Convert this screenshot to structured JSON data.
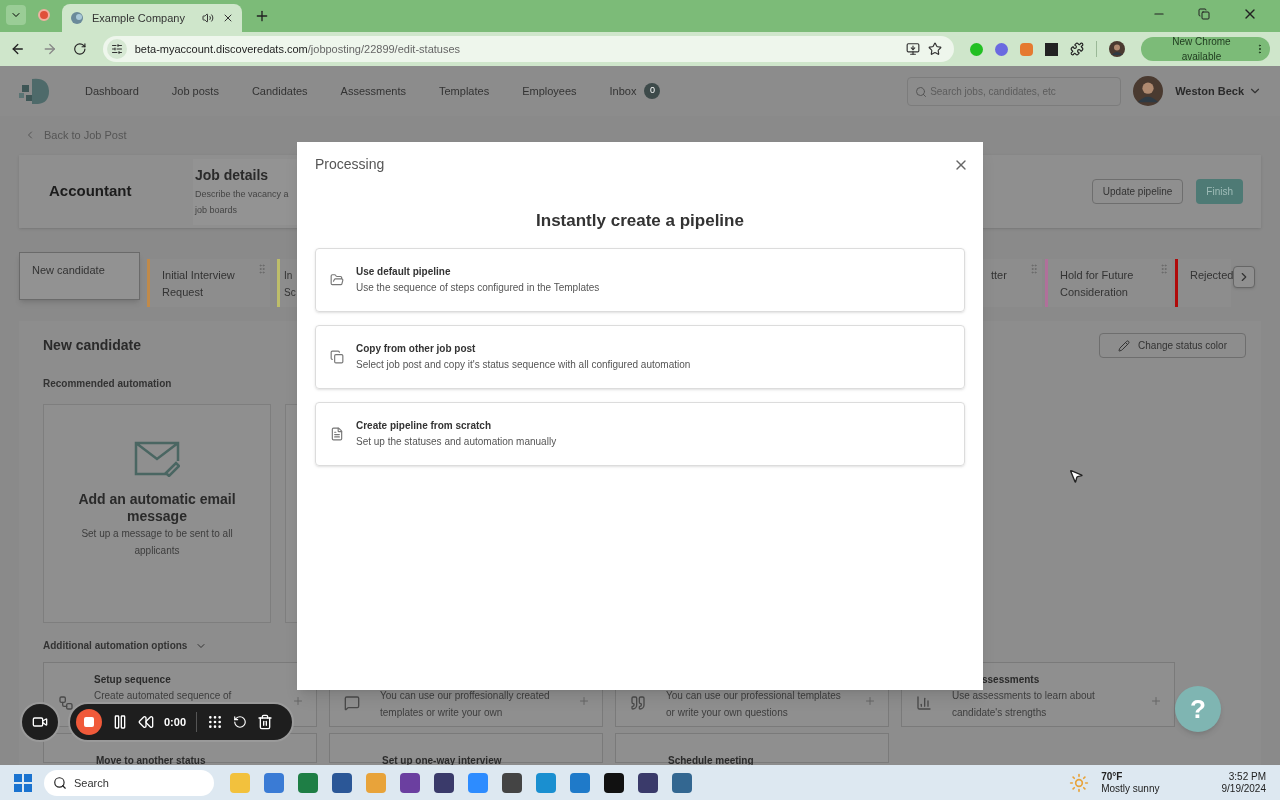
{
  "browser": {
    "tab_title": "Example Company",
    "url_host": "beta-myaccount.discoveredats.com",
    "url_path": "/jobposting/22899/edit-statuses",
    "update_button": "New Chrome available"
  },
  "nav": {
    "items": [
      {
        "label": "Dashboard"
      },
      {
        "label": "Job posts"
      },
      {
        "label": "Candidates"
      },
      {
        "label": "Assessments"
      },
      {
        "label": "Templates"
      },
      {
        "label": "Employees"
      }
    ],
    "inbox": {
      "label": "Inbox",
      "count": "0"
    },
    "search": {
      "placeholder": "Search jobs, candidates, etc"
    },
    "user": "Weston Beck"
  },
  "back_link": "Back to Job Post",
  "job": {
    "title": "Accountant",
    "details_title": "Job details",
    "details_lines": [
      "Describe the vacancy a",
      "job boards"
    ],
    "update_button": "Update pipeline",
    "finish_button": "Finish"
  },
  "stages_left": [
    {
      "label": "New candidate",
      "selected": true
    },
    {
      "label": "Initial Interview Request",
      "selected": false,
      "color": "#c08a4a"
    },
    {
      "label": "In Sc",
      "selected": false,
      "color": "#bdbd6a"
    }
  ],
  "stages_right": [
    {
      "label": "tter",
      "selected": false
    },
    {
      "label": "Hold for Future Consideration",
      "selected": false,
      "color": "#b0709a"
    },
    {
      "label": "Rejected",
      "selected": false,
      "color": "#b00a0a"
    }
  ],
  "panel": {
    "title": "New candidate",
    "change_color_button": "Change status color",
    "recommended_heading": "Recommended automation",
    "recommended": {
      "title": "Add an automatic email message",
      "text": "Set up a message to be sent to all applicants"
    },
    "more_heading": "Additional automation options",
    "options": [
      {
        "kind": "sequence",
        "title": "Setup sequence",
        "text": "Create automated sequence of"
      },
      {
        "kind": "message",
        "text": "You can use our proffesionally created templates or write your own"
      },
      {
        "kind": "quote",
        "text": "You can use our professional templates or write your own questions"
      },
      {
        "kind": "chart",
        "title": "ssessments",
        "text": "Use assessments to learn about candidate's strengths"
      }
    ],
    "options_row2": [
      "Move to another status",
      "Set up one-way interview",
      "Schedule meeting"
    ]
  },
  "modal": {
    "title": "Processing",
    "heading": "Instantly create a pipeline",
    "options": [
      {
        "kind": "folder",
        "title": "Use default pipeline",
        "text": "Use the sequence of steps configured in the Templates"
      },
      {
        "kind": "copy",
        "title": "Copy from other job post",
        "text": "Select job post and copy it's status sequence with all configured automation"
      },
      {
        "kind": "file",
        "title": "Create pipeline from scratch",
        "text": "Set up the statuses and automation manually"
      }
    ]
  },
  "recorder": {
    "time": "0:00"
  },
  "help_button": "?",
  "taskbar": {
    "search_placeholder": "Search",
    "temperature": "70°F",
    "weather": "Mostly sunny",
    "time": "3:52 PM",
    "date": "9/19/2024"
  }
}
